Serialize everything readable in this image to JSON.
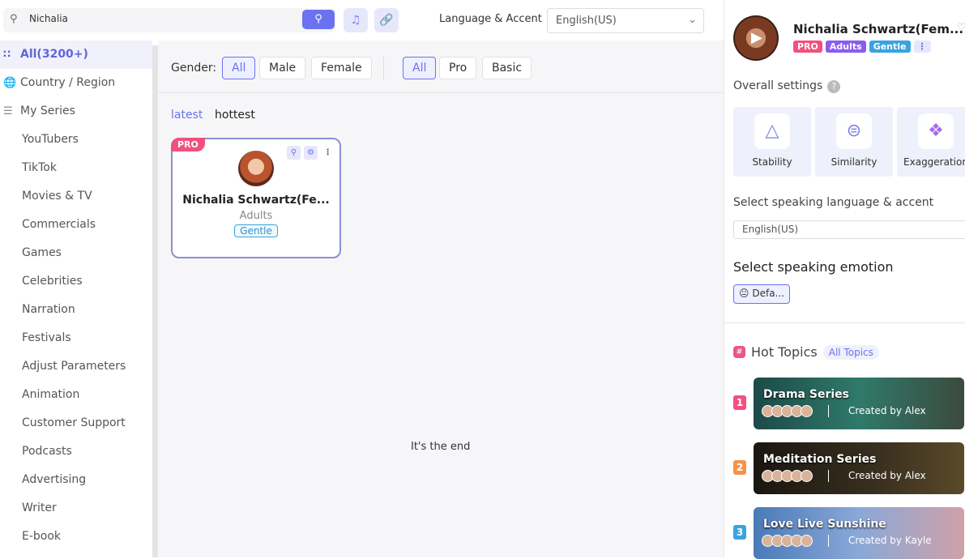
{
  "search": {
    "value": "Nichalia"
  },
  "language": {
    "label": "Language & Accent",
    "value": "English(US)"
  },
  "sidebar": {
    "all": "All(3200+)",
    "country": "Country / Region",
    "series": "My Series",
    "items": [
      "YouTubers",
      "TikTok",
      "Movies & TV",
      "Commercials",
      "Games",
      "Celebrities",
      "Narration",
      "Festivals",
      "Adjust Parameters",
      "Animation",
      "Customer Support",
      "Podcasts",
      "Advertising",
      "Writer",
      "E-book"
    ]
  },
  "filters": {
    "gender_label": "Gender:",
    "gender": [
      "All",
      "Male",
      "Female"
    ],
    "tier": [
      "All",
      "Pro",
      "Basic"
    ]
  },
  "sort": {
    "latest": "latest",
    "hottest": "hottest"
  },
  "card": {
    "badge": "PRO",
    "name": "Nichalia Schwartz(Fe...",
    "age": "Adults",
    "tag": "Gentle"
  },
  "end_text": "It's the end",
  "panel": {
    "name": "Nichalia Schwartz(Fem...",
    "tags": [
      "PRO",
      "Adults",
      "Gentle"
    ],
    "tag_colors": [
      "#f0517f",
      "#8a5cf0",
      "#3aa3e0"
    ],
    "overall": "Overall settings",
    "settings": [
      "Stability",
      "Similarity",
      "Exaggeration"
    ],
    "lang_label": "Select speaking language & accent",
    "lang_value": "English(US)",
    "emotion_label": "Select speaking emotion",
    "emotion_value": "Defa...",
    "hot_topics": "Hot Topics",
    "all_topics": "All Topics",
    "topics": [
      {
        "rank": "1",
        "title": "Drama Series",
        "by": "Created by Alex",
        "color": "#f0517f"
      },
      {
        "rank": "2",
        "title": "Meditation Series",
        "by": "Created by Alex",
        "color": "#f5934a"
      },
      {
        "rank": "3",
        "title": "Love Live Sunshine",
        "by": "Created by Kayle",
        "color": "#3aa3e0"
      }
    ]
  },
  "accent": "#6b72f0"
}
